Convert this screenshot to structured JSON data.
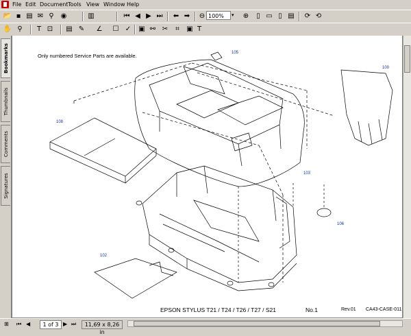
{
  "menu": {
    "items": [
      "File",
      "Edit",
      "Document",
      "Tools",
      "View",
      "Window",
      "Help"
    ]
  },
  "toolbar": {
    "zoom_value": "100%"
  },
  "side_panel": {
    "tabs": [
      "Bookmarks",
      "Thumbnails",
      "Comments",
      "Signatures"
    ]
  },
  "status_bar": {
    "page_indicator": "1 of 3",
    "page_size": "11,69 x 8,26 in"
  },
  "document": {
    "note": "Only numbered Service Parts are available.",
    "footer_model": "EPSON STYLUS T21 / T24 / T26 / T27 / S21",
    "footer_no": "No.1",
    "footer_rev": "Rev.01",
    "footer_code": "CA43-CASE-011",
    "callouts": {
      "c105": "105",
      "c100": "100",
      "c108": "108",
      "c103": "103",
      "c106": "106",
      "c102": "102"
    }
  },
  "colors": {
    "chrome": "#d4d0c8",
    "callout_text": "#1030a0",
    "page": "#ffffff"
  }
}
